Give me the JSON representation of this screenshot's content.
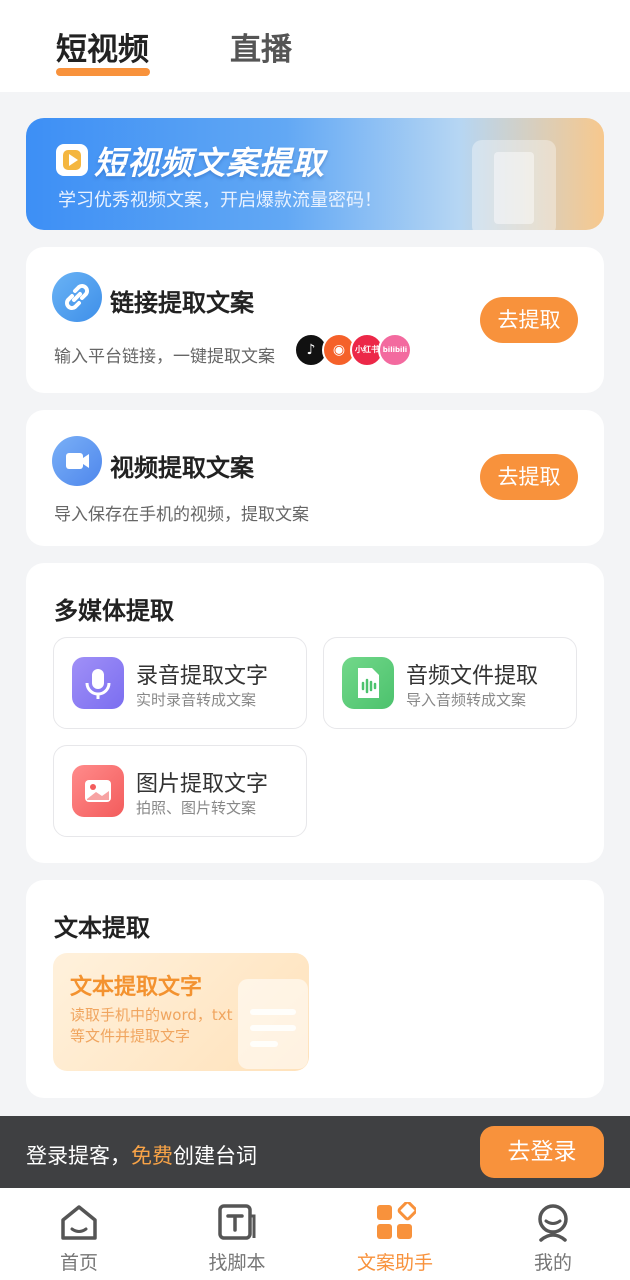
{
  "top_tabs": [
    {
      "label": "短视频",
      "active": true
    },
    {
      "label": "直播",
      "active": false
    }
  ],
  "banner": {
    "title": "短视频文案提取",
    "subtitle": "学习优秀视频文案，开启爆款流量密码！"
  },
  "link_card": {
    "title": "链接提取文案",
    "description": "输入平台链接，一键提取文案",
    "button": "去提取",
    "platforms": [
      "douyin-logo",
      "kuaishou-logo",
      "xiaohongshu-logo",
      "bilibili-logo"
    ],
    "platform_text": {
      "xhs": "小红书",
      "bili": "bilibili"
    }
  },
  "video_card": {
    "title": "视频提取文案",
    "description": "导入保存在手机的视频，提取文案",
    "button": "去提取"
  },
  "media_section": {
    "title": "多媒体提取",
    "tiles": [
      {
        "title": "录音提取文字",
        "subtitle": "实时录音转成文案",
        "icon": "microphone-icon"
      },
      {
        "title": "音频文件提取",
        "subtitle": "导入音频转成文案",
        "icon": "audio-file-icon"
      },
      {
        "title": "图片提取文字",
        "subtitle": "拍照、图片转文案",
        "icon": "image-icon"
      }
    ]
  },
  "text_section": {
    "title": "文本提取",
    "tile_title": "文本提取文字",
    "tile_desc": "读取手机中的word，txt等文件并提取文字"
  },
  "login_bar": {
    "text_before": "登录提客，",
    "highlight": "免费",
    "text_after": "创建台词",
    "button": "去登录"
  },
  "bottom_nav": [
    {
      "label": "首页",
      "icon": "home-icon",
      "active": false
    },
    {
      "label": "找脚本",
      "icon": "script-icon",
      "active": false
    },
    {
      "label": "文案助手",
      "icon": "apps-icon",
      "active": true
    },
    {
      "label": "我的",
      "icon": "profile-icon",
      "active": false
    }
  ],
  "colors": {
    "accent": "#f8923c",
    "login_bar_bg": "#3f4042"
  }
}
